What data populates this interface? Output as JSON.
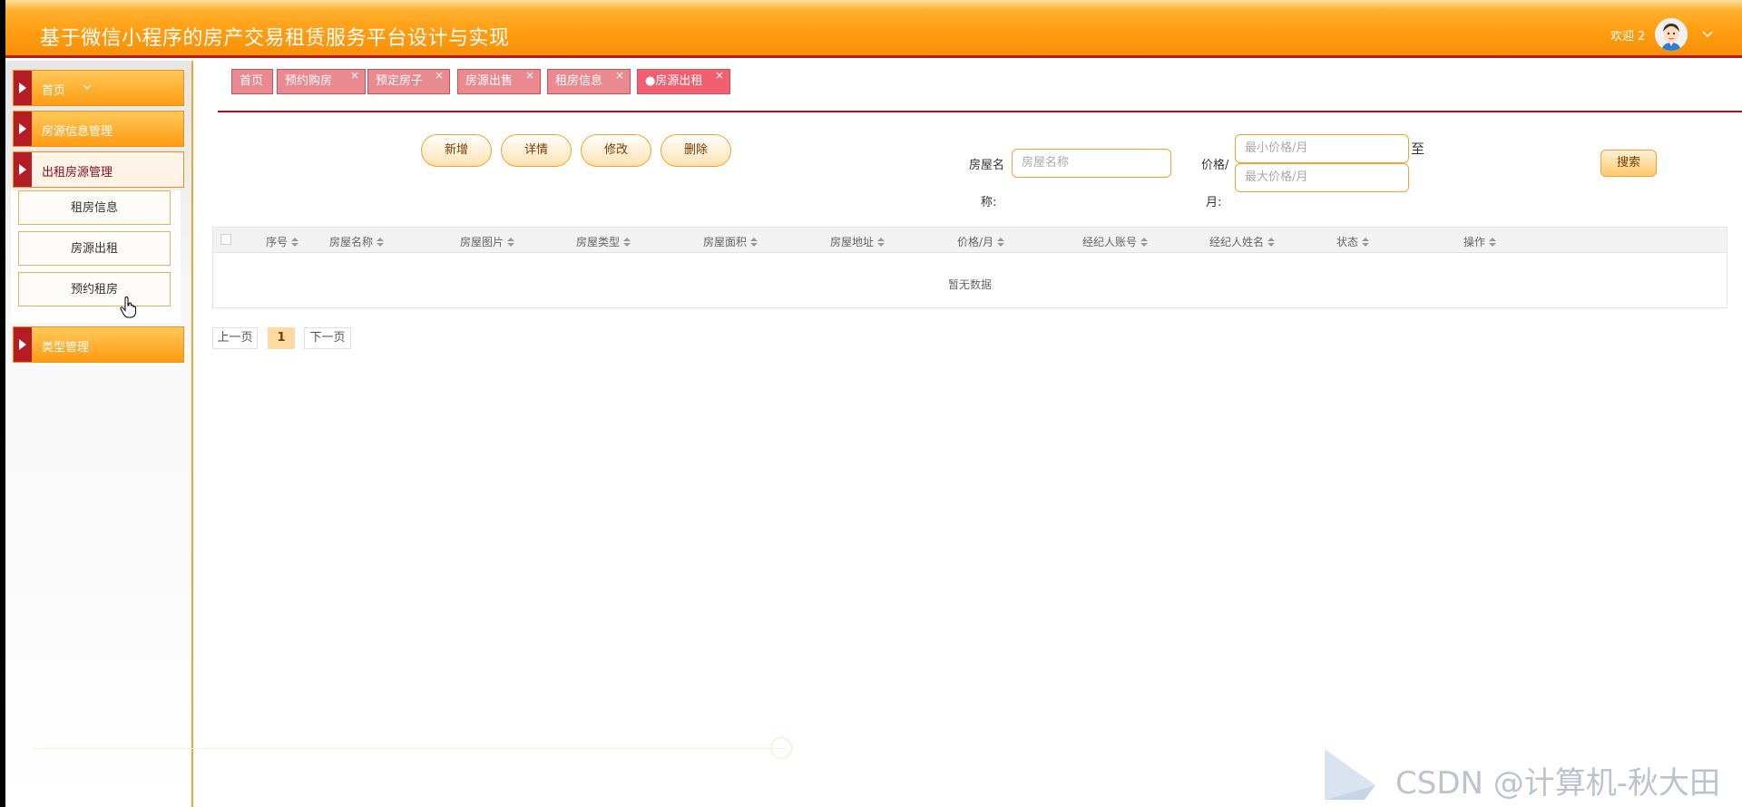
{
  "header": {
    "title": "基于微信小程序的房产交易租赁服务平台设计与实现",
    "welcome": "欢迎 2"
  },
  "sidebar": {
    "menus": [
      {
        "label": "首页"
      },
      {
        "label": "房源信息管理"
      },
      {
        "label": "出租房源管理"
      },
      {
        "label": "类型管理"
      }
    ],
    "submenu": [
      {
        "label": "租房信息"
      },
      {
        "label": "房源出租"
      },
      {
        "label": "预约租房"
      }
    ]
  },
  "tabs": [
    {
      "label": "首页"
    },
    {
      "label": "预约购房",
      "close": "×"
    },
    {
      "label": "预定房子",
      "close": "×"
    },
    {
      "label": "房源出售",
      "close": "×"
    },
    {
      "label": "租房信息",
      "close": "×"
    },
    {
      "label": "●房源出租",
      "close": "×"
    }
  ],
  "toolbar": {
    "add": "新增",
    "detail": "详情",
    "edit": "修改",
    "delete": "删除",
    "search": "搜索"
  },
  "search": {
    "name_label_line1": "房屋名",
    "name_label_line2": "称:",
    "name_placeholder": "房屋名称",
    "price_label_line1": "价格/",
    "price_label_line2": "月:",
    "min_price_placeholder": "最小价格/月",
    "max_price_placeholder": "最大价格/月",
    "to": "至"
  },
  "table": {
    "columns": [
      "序号",
      "房屋名称",
      "房屋图片",
      "房屋类型",
      "房屋面积",
      "房屋地址",
      "价格/月",
      "经纪人账号",
      "经纪人姓名",
      "状态",
      "操作"
    ],
    "empty_text": "暂无数据"
  },
  "pager": {
    "prev": "上一页",
    "current": "1",
    "next": "下一页"
  },
  "watermark": "CSDN @计算机-秋大田",
  "colors": {
    "accent": "#ff9c10",
    "brand_red": "#b51c26",
    "tab_pink": "#e88a8f"
  }
}
